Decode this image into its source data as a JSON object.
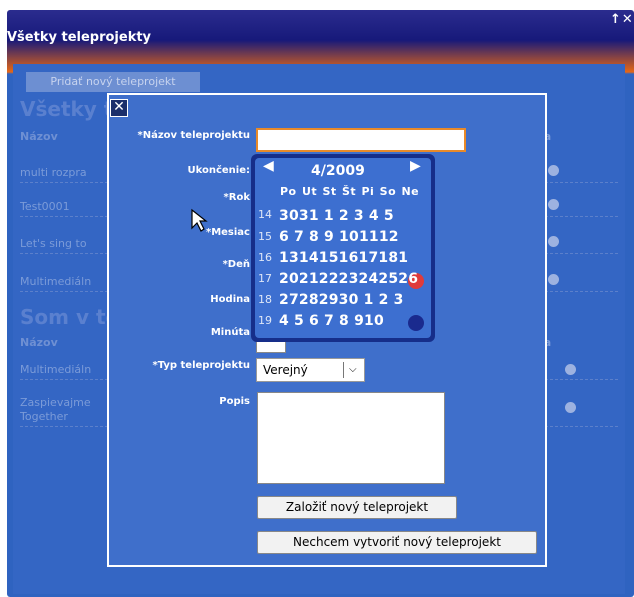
{
  "window": {
    "title": "Všetky teleprojekty",
    "controls": "↑✕"
  },
  "background": {
    "add_button": "Pridať nový teleprojekt",
    "section1_heading": "Všetky t",
    "section2_heading": "Som v te",
    "col_name": "Názov",
    "col_right": "ia",
    "rows1": [
      "multi rozpra",
      "Test0001",
      "Let's sing to",
      "Multimediáln"
    ],
    "rows2": [
      "Multimediáln",
      "Zaspievajme",
      "Together"
    ]
  },
  "dialog": {
    "close": "✕",
    "labels": {
      "name": "*Názov teleprojektu",
      "end": "Ukončenie:",
      "year": "*Rok",
      "month": "*Mesiac",
      "day": "*Deň",
      "hour": "Hodina",
      "minute": "Minúta",
      "type": "*Typ teleprojektu",
      "description": "Popis"
    },
    "name_value": "",
    "type_value": "Verejný",
    "create_button": "Založiť nový teleprojekt",
    "cancel_button": "Nechcem vytvoriť nový teleprojekt"
  },
  "calendar": {
    "title": "4/2009",
    "prev": "◀",
    "next": "▶",
    "weekdays": "Po Ut St Št Pi So Ne",
    "weeks": [
      "14",
      "15",
      "16",
      "17",
      "18",
      "19"
    ],
    "rows": [
      "3031 1 2 3 4 5",
      "6 7 8 9 101112",
      "1314151617181",
      "20212223242526",
      "27282930 1 2 3",
      "4 5 6 7 8 910"
    ],
    "today_highlight_color": "#e03b3b",
    "selected_highlight_color": "#1a2a8e"
  }
}
